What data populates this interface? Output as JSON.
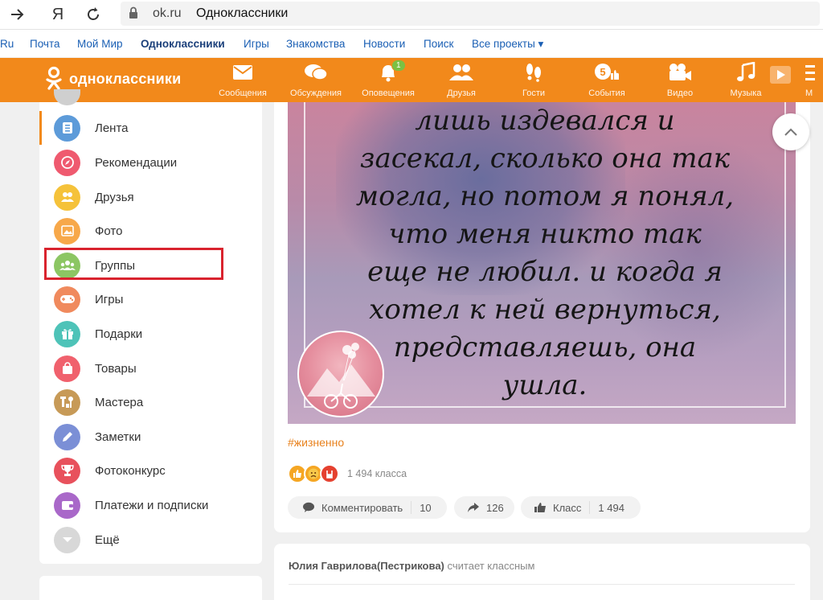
{
  "browser": {
    "domain": "ok.ru",
    "title": "Одноклассники",
    "yandex_glyph": "Я"
  },
  "projects": [
    {
      "label": "Ru"
    },
    {
      "label": "Почта"
    },
    {
      "label": "Мой Мир"
    },
    {
      "label": "Одноклассники",
      "active": true
    },
    {
      "label": "Игры"
    },
    {
      "label": "Знакомства"
    },
    {
      "label": "Новости"
    },
    {
      "label": "Поиск"
    },
    {
      "label": "Все проекты ▾"
    }
  ],
  "header": {
    "logo_text": "одноклассники",
    "nav": [
      {
        "label": "Сообщения",
        "icon": "envelope-icon"
      },
      {
        "label": "Обсуждения",
        "icon": "chat-icon"
      },
      {
        "label": "Оповещения",
        "icon": "bell-icon",
        "badge": "1"
      },
      {
        "label": "Друзья",
        "icon": "friends-icon"
      },
      {
        "label": "Гости",
        "icon": "footprints-icon"
      },
      {
        "label": "События",
        "icon": "events-icon",
        "badge_inline": "5"
      },
      {
        "label": "Видео",
        "icon": "video-camera-icon"
      },
      {
        "label": "Музыка",
        "icon": "music-note-icon"
      },
      {
        "label": "М",
        "icon": "more-icon"
      }
    ]
  },
  "sidebar": {
    "items": [
      {
        "label": "Лента",
        "icon": "feed-icon",
        "color": "#5d9bd9",
        "active": true
      },
      {
        "label": "Рекомендации",
        "icon": "compass-icon",
        "color": "#ef5a6f"
      },
      {
        "label": "Друзья",
        "icon": "friends-icon",
        "color": "#f5c23a"
      },
      {
        "label": "Фото",
        "icon": "photo-icon",
        "color": "#f7a84a"
      },
      {
        "label": "Группы",
        "icon": "groups-icon",
        "color": "#8cc663"
      },
      {
        "label": "Игры",
        "icon": "gamepad-icon",
        "color": "#f08a5d"
      },
      {
        "label": "Подарки",
        "icon": "gift-icon",
        "color": "#4ec3b8"
      },
      {
        "label": "Товары",
        "icon": "bag-icon",
        "color": "#f0616d"
      },
      {
        "label": "Мастера",
        "icon": "tools-icon",
        "color": "#c79a57"
      },
      {
        "label": "Заметки",
        "icon": "pencil-icon",
        "color": "#7b8fd6"
      },
      {
        "label": "Фотоконкурс",
        "icon": "trophy-icon",
        "color": "#e8515c"
      },
      {
        "label": "Платежи и подписки",
        "icon": "wallet-icon",
        "color": "#a968c9"
      },
      {
        "label": "Ещё",
        "icon": "chevron-down-icon",
        "color": "#d8d8d8"
      }
    ]
  },
  "post": {
    "text_lines": [
      "лишь издевался и",
      "засекал, сколько она так",
      "могла, но потом я понял,",
      "что меня никто так",
      "еще не любил. и когда я",
      "хотел к ней вернуться,",
      "представляешь, она",
      "ушла."
    ],
    "hashtag": "#жизненно",
    "class_count_text": "1 494 класса",
    "actions": {
      "comment_label": "Комментировать",
      "comment_count": "10",
      "share_count": "126",
      "class_label": "Класс",
      "class_count": "1 494"
    }
  },
  "next_post": {
    "author": "Юлия Гаврилова(Пестрикова)",
    "action_text": "считает классным"
  },
  "colors": {
    "ok_orange": "#f2891b",
    "highlight_red": "#d9232e",
    "link_blue": "#1a5fb4"
  }
}
